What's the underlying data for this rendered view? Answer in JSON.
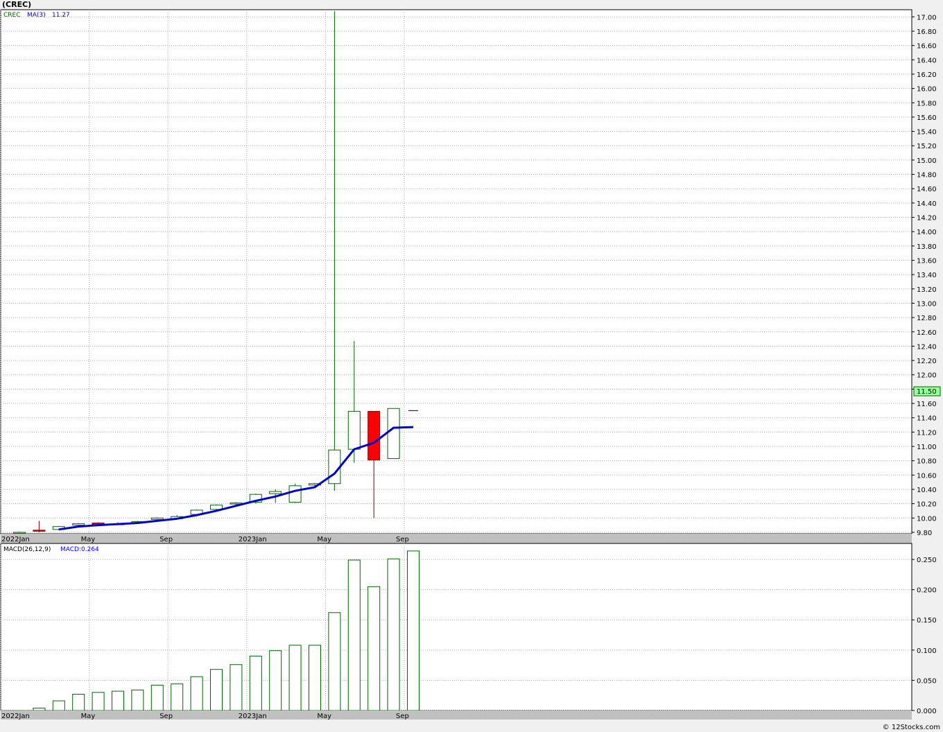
{
  "header": {
    "title": "(CREC)"
  },
  "footer": {
    "copyright": "© 12Stocks.com"
  },
  "colors": {
    "up": "#006400",
    "down": "#ff0000",
    "ma": "#0000cd",
    "macd_label": "#0000ff",
    "price_box": "#99ff99",
    "grid": "#aaaaaa"
  },
  "chart_data": [
    {
      "type": "candlestick",
      "legend": {
        "symbol": "CREC",
        "ma_label": "MA(3)",
        "ma_value": "11.27"
      },
      "last_price_label": "11.50",
      "x_tick_labels": [
        "2022Jan",
        "May",
        "Sep",
        "2023Jan",
        "May",
        "Sep"
      ],
      "x_tick_index": [
        0,
        4,
        8,
        12,
        16,
        20
      ],
      "ylim": [
        9.78,
        17.1
      ],
      "y_ticks": [
        "9.80",
        "10.00",
        "10.20",
        "10.40",
        "10.60",
        "10.80",
        "11.00",
        "11.20",
        "11.40",
        "11.60",
        "11.80",
        "12.00",
        "12.20",
        "12.40",
        "12.60",
        "12.80",
        "13.00",
        "13.20",
        "13.40",
        "13.60",
        "13.80",
        "14.00",
        "14.20",
        "14.40",
        "14.60",
        "14.80",
        "15.00",
        "15.20",
        "15.40",
        "15.60",
        "15.80",
        "16.00",
        "16.20",
        "16.40",
        "16.60",
        "16.80",
        "17.00"
      ],
      "candles": [
        {
          "i": 0,
          "o": 9.8,
          "h": 9.81,
          "l": 9.79,
          "c": 9.8
        },
        {
          "i": 1,
          "o": 9.83,
          "h": 9.96,
          "l": 9.8,
          "c": 9.82
        },
        {
          "i": 2,
          "o": 9.84,
          "h": 9.89,
          "l": 9.83,
          "c": 9.88
        },
        {
          "i": 3,
          "o": 9.9,
          "h": 9.93,
          "l": 9.88,
          "c": 9.92
        },
        {
          "i": 4,
          "o": 9.93,
          "h": 9.94,
          "l": 9.9,
          "c": 9.9
        },
        {
          "i": 5,
          "o": 9.91,
          "h": 9.94,
          "l": 9.9,
          "c": 9.92
        },
        {
          "i": 6,
          "o": 9.93,
          "h": 9.96,
          "l": 9.92,
          "c": 9.95
        },
        {
          "i": 7,
          "o": 9.98,
          "h": 10.01,
          "l": 9.95,
          "c": 10.0
        },
        {
          "i": 8,
          "o": 9.99,
          "h": 10.04,
          "l": 9.98,
          "c": 10.02
        },
        {
          "i": 9,
          "o": 10.05,
          "h": 10.12,
          "l": 10.03,
          "c": 10.11
        },
        {
          "i": 10,
          "o": 10.12,
          "h": 10.19,
          "l": 10.1,
          "c": 10.18
        },
        {
          "i": 11,
          "o": 10.2,
          "h": 10.22,
          "l": 10.18,
          "c": 10.21
        },
        {
          "i": 12,
          "o": 10.22,
          "h": 10.34,
          "l": 10.2,
          "c": 10.33
        },
        {
          "i": 13,
          "o": 10.34,
          "h": 10.4,
          "l": 10.21,
          "c": 10.37
        },
        {
          "i": 14,
          "o": 10.22,
          "h": 10.48,
          "l": 10.21,
          "c": 10.45
        },
        {
          "i": 15,
          "o": 10.46,
          "h": 10.49,
          "l": 10.43,
          "c": 10.48
        },
        {
          "i": 16,
          "o": 10.48,
          "h": 17.08,
          "l": 10.38,
          "c": 10.95
        },
        {
          "i": 17,
          "o": 10.96,
          "h": 12.47,
          "l": 10.77,
          "c": 11.49
        },
        {
          "i": 18,
          "o": 11.49,
          "h": 11.49,
          "l": 10.0,
          "c": 10.81
        },
        {
          "i": 19,
          "o": 10.83,
          "h": 11.53,
          "l": 10.83,
          "c": 11.53
        },
        {
          "i": 20,
          "o": 11.5,
          "h": 11.5,
          "l": 11.5,
          "c": 11.5
        }
      ],
      "ma_series": [
        9.84,
        9.87,
        9.89,
        9.9,
        9.91,
        9.93,
        9.95,
        9.98,
        10.01,
        10.04,
        10.09,
        10.14,
        10.19,
        10.24,
        10.3,
        10.36,
        10.41,
        10.45,
        10.62,
        10.96,
        11.05,
        11.26,
        11.27
      ],
      "ma_index": [
        2,
        3,
        4,
        5,
        6,
        7,
        8,
        9,
        10,
        11,
        12,
        13,
        14,
        15,
        16,
        16.9,
        17,
        18,
        19,
        19,
        20,
        20.5,
        21
      ],
      "ma_points": [
        {
          "i": 2,
          "v": 9.84
        },
        {
          "i": 3,
          "v": 9.88
        },
        {
          "i": 4,
          "v": 9.9
        },
        {
          "i": 6,
          "v": 9.93
        },
        {
          "i": 7,
          "v": 9.96
        },
        {
          "i": 8,
          "v": 9.99
        },
        {
          "i": 9,
          "v": 10.04
        },
        {
          "i": 10,
          "v": 10.1
        },
        {
          "i": 11,
          "v": 10.17
        },
        {
          "i": 12,
          "v": 10.24
        },
        {
          "i": 13,
          "v": 10.3
        },
        {
          "i": 14,
          "v": 10.38
        },
        {
          "i": 15,
          "v": 10.43
        },
        {
          "i": 16,
          "v": 10.62
        },
        {
          "i": 17,
          "v": 10.96
        },
        {
          "i": 18,
          "v": 11.05
        },
        {
          "i": 19,
          "v": 11.26
        },
        {
          "i": 20,
          "v": 11.27
        }
      ]
    },
    {
      "type": "bar",
      "legend": {
        "label": "MACD(26,12,9)",
        "value_label": "MACD:0.264"
      },
      "x_tick_labels": [
        "2022Jan",
        "May",
        "Sep",
        "2023Jan",
        "May",
        "Sep"
      ],
      "x_tick_index": [
        0,
        4,
        8,
        12,
        16,
        20
      ],
      "ylim": [
        0.0,
        0.265
      ],
      "y_ticks": [
        "0.000",
        "0.050",
        "0.100",
        "0.150",
        "0.200",
        "0.250"
      ],
      "values": [
        0.0,
        0.004,
        0.016,
        0.027,
        0.03,
        0.032,
        0.034,
        0.042,
        0.044,
        0.056,
        0.068,
        0.076,
        0.09,
        0.099,
        0.108,
        0.108,
        0.162,
        0.249,
        0.205,
        0.251,
        0.264
      ]
    }
  ]
}
